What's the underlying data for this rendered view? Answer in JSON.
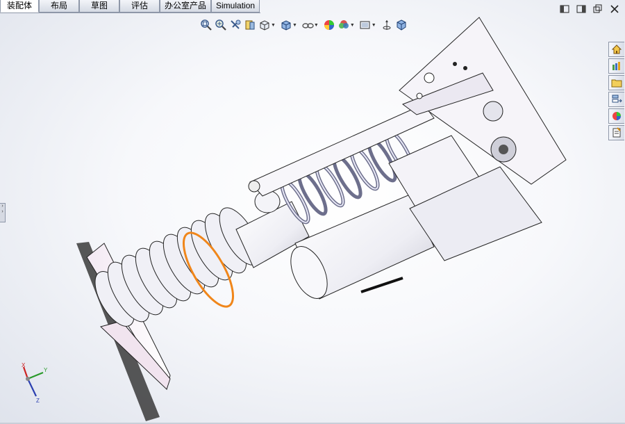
{
  "tabs": [
    {
      "label": "装配体",
      "active": true
    },
    {
      "label": "布局",
      "active": false
    },
    {
      "label": "草图",
      "active": false
    },
    {
      "label": "评估",
      "active": false
    },
    {
      "label": "办公室产品",
      "active": false
    },
    {
      "label": "Simulation",
      "active": false
    }
  ],
  "heads_up_toolbar": [
    "zoom-to-fit-icon",
    "zoom-to-area-icon",
    "previous-view-icon",
    "section-view-icon",
    "view-orientation-icon",
    "display-style-icon",
    "hide-show-items-icon",
    "edit-appearance-icon",
    "apply-scene-icon",
    "view-settings-icon",
    "view-3d-icon"
  ],
  "task_pane": [
    "home-icon",
    "design-library-icon",
    "file-explorer-icon",
    "view-palette-icon",
    "appearances-icon",
    "custom-properties-icon"
  ],
  "triad": {
    "x": "X",
    "y": "Y",
    "z": "Z"
  },
  "colors": {
    "selection_ring": "#f0861a",
    "model_edge": "#222222",
    "model_face": "#f4f2f8",
    "bellows": "#ececf2"
  }
}
